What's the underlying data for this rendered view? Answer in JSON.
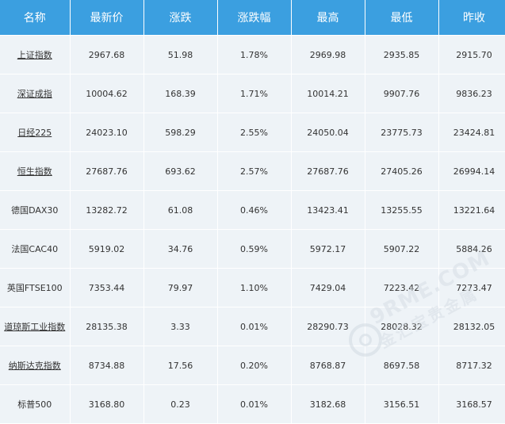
{
  "columns": [
    "名称",
    "最新价",
    "涨跌",
    "涨跌幅",
    "最高",
    "最低",
    "昨收"
  ],
  "rows": [
    {
      "name": "上证指数",
      "is_link": true,
      "cells": [
        "2967.68",
        "51.98",
        "1.78%",
        "2969.98",
        "2935.85",
        "2915.70"
      ]
    },
    {
      "name": "深证成指",
      "is_link": true,
      "cells": [
        "10004.62",
        "168.39",
        "1.71%",
        "10014.21",
        "9907.76",
        "9836.23"
      ]
    },
    {
      "name": "日经225",
      "is_link": true,
      "cells": [
        "24023.10",
        "598.29",
        "2.55%",
        "24050.04",
        "23775.73",
        "23424.81"
      ]
    },
    {
      "name": "恒生指数",
      "is_link": true,
      "cells": [
        "27687.76",
        "693.62",
        "2.57%",
        "27687.76",
        "27405.26",
        "26994.14"
      ]
    },
    {
      "name": "德国DAX30",
      "is_link": false,
      "cells": [
        "13282.72",
        "61.08",
        "0.46%",
        "13423.41",
        "13255.55",
        "13221.64"
      ]
    },
    {
      "name": "法国CAC40",
      "is_link": false,
      "cells": [
        "5919.02",
        "34.76",
        "0.59%",
        "5972.17",
        "5907.22",
        "5884.26"
      ]
    },
    {
      "name": "英国FTSE100",
      "is_link": false,
      "cells": [
        "7353.44",
        "79.97",
        "1.10%",
        "7429.04",
        "7223.42",
        "7273.47"
      ]
    },
    {
      "name": "道琼斯工业指数",
      "is_link": true,
      "cells": [
        "28135.38",
        "3.33",
        "0.01%",
        "28290.73",
        "28028.32",
        "28132.05"
      ]
    },
    {
      "name": "纳斯达克指数",
      "is_link": true,
      "cells": [
        "8734.88",
        "17.56",
        "0.20%",
        "8768.87",
        "8697.58",
        "8717.32"
      ]
    },
    {
      "name": "标普500",
      "is_link": false,
      "cells": [
        "3168.80",
        "0.23",
        "0.01%",
        "3182.68",
        "3156.51",
        "3168.57"
      ]
    }
  ],
  "watermark": {
    "line1": "9RME.COM",
    "line2": "金汇宝贵金属"
  },
  "colors": {
    "header_bg": "#3b9fe0",
    "row_bg": "#eef3f7",
    "text": "#333333"
  }
}
